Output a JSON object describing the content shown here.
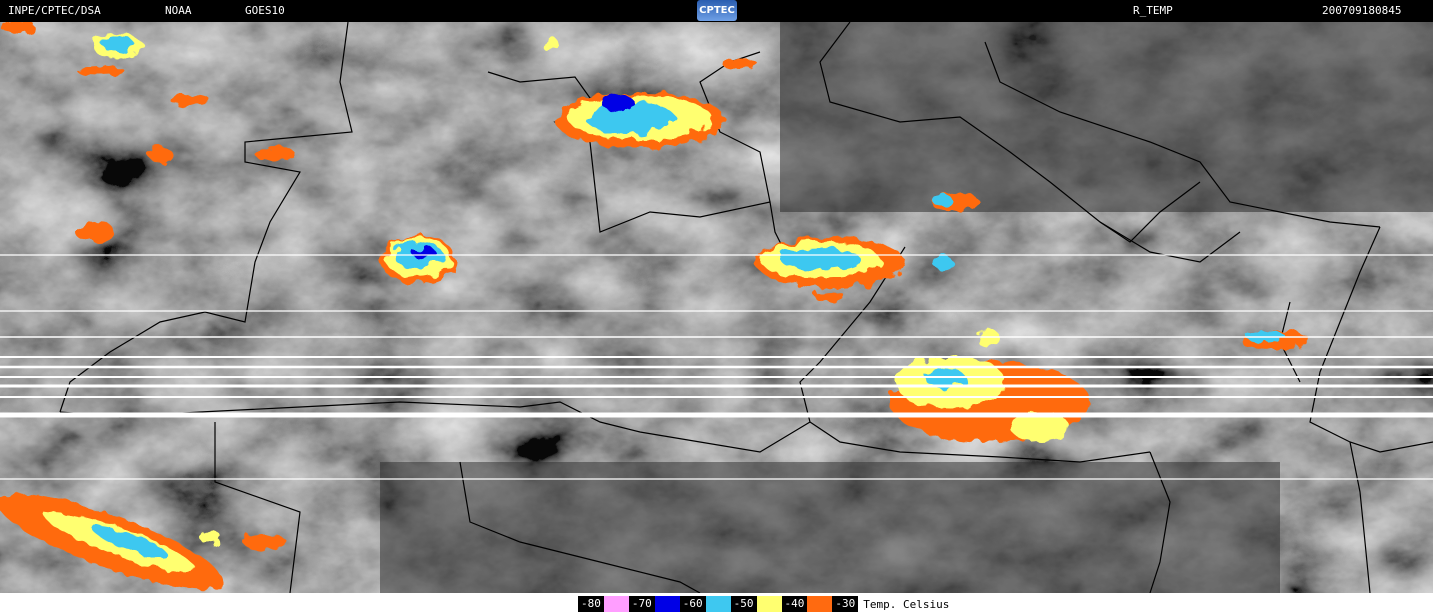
{
  "header": {
    "institution": "INPE/CPTEC/DSA",
    "agency": "NOAA",
    "satellite": "GOES10",
    "logo_text": "CPTEC",
    "product": "R_TEMP",
    "timestamp": "200709180845"
  },
  "legend": {
    "title": "Temp. Celsius",
    "items": [
      {
        "label": "-80",
        "color": "#ff9eff"
      },
      {
        "label": "-70",
        "color": "#0000e6"
      },
      {
        "label": "-60",
        "color": "#3ec8f0"
      },
      {
        "label": "-50",
        "color": "#ffff70"
      },
      {
        "label": "-40",
        "color": "#ff6a10"
      },
      {
        "label": "-30",
        "color": ""
      }
    ]
  },
  "colors": {
    "background_cloud": "#6a6a6a",
    "borders": "#000000",
    "scan_lines": "#ffffff"
  }
}
